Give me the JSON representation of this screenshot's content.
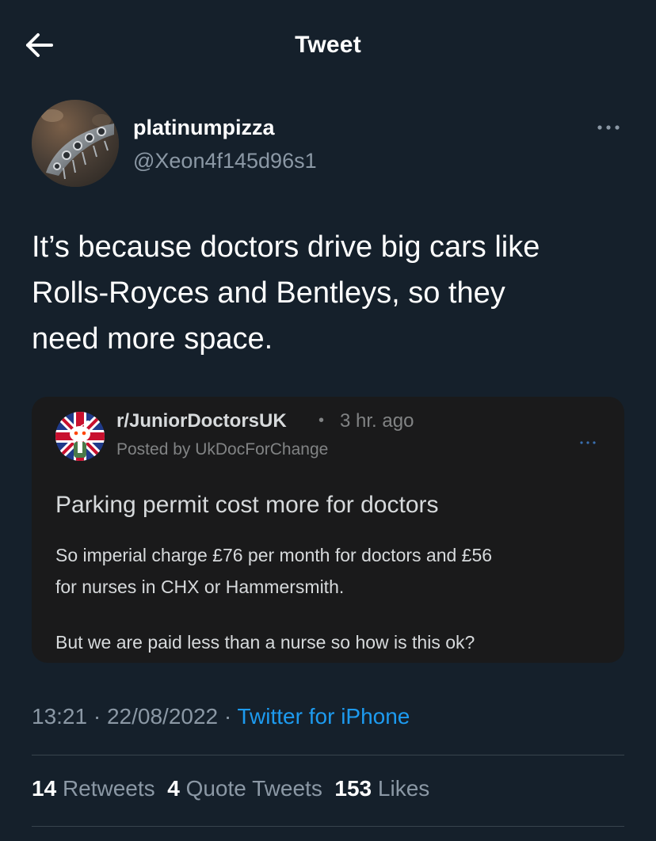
{
  "header": {
    "title": "Tweet"
  },
  "author": {
    "name": "platinumpizza",
    "handle": "@Xeon4f145d96s1"
  },
  "tweet": {
    "lines": [
      "It’s because doctors drive big cars like",
      "Rolls-Royces and Bentleys, so they",
      "need more space."
    ]
  },
  "embed": {
    "subreddit": "r/JuniorDoctorsUK",
    "separator": "•",
    "time": "3 hr. ago",
    "posted_by": "Posted by UkDocForChange",
    "title": "Parking permit cost more for doctors",
    "body_lines": [
      "So imperial charge £76 per month for doctors and £56",
      "for nurses in CHX or Hammersmith.",
      "",
      "But we are paid less than a nurse so how is this ok?"
    ]
  },
  "meta": {
    "time": "13:21",
    "dot1": " · ",
    "date": "22/08/2022",
    "dot2": " · ",
    "source": "Twitter for iPhone"
  },
  "stats": {
    "retweets_count": "14",
    "retweets_label": "Retweets",
    "quotes_count": "4",
    "quotes_label": "Quote Tweets",
    "likes_count": "153",
    "likes_label": "Likes"
  },
  "colors": {
    "background": "#15202b",
    "secondary_text": "#8b98a5",
    "link": "#1d9bf0",
    "card_background": "#1a1a1b",
    "divider": "#38444d"
  },
  "icons": {
    "back": "arrow-left-icon",
    "more": "more-horizontal-icon",
    "card_more": "more-horizontal-icon",
    "card_avatar": "reddit-snoo-union-jack-icon"
  }
}
